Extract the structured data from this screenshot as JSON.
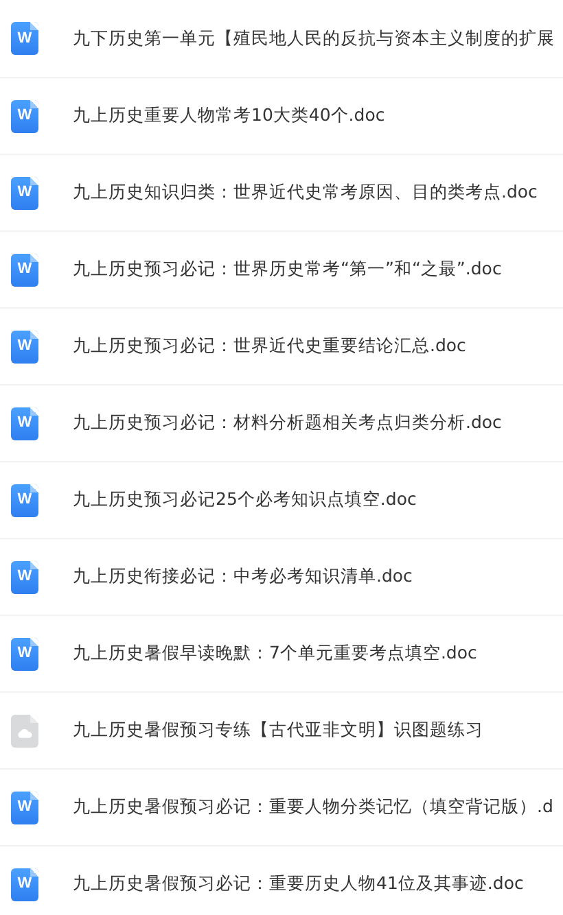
{
  "files": [
    {
      "kind": "word",
      "badge": "W",
      "name": "九下历史第一单元【殖民地人民的反抗与资本主义制度的扩展"
    },
    {
      "kind": "word",
      "badge": "W",
      "name": "九上历史重要人物常考10大类40个.doc"
    },
    {
      "kind": "word",
      "badge": "W",
      "name": "九上历史知识归类：世界近代史常考原因、目的类考点.doc"
    },
    {
      "kind": "word",
      "badge": "W",
      "name": "九上历史预习必记：世界历史常考“第一”和“之最”.doc"
    },
    {
      "kind": "word",
      "badge": "W",
      "name": "九上历史预习必记：世界近代史重要结论汇总.doc"
    },
    {
      "kind": "word",
      "badge": "W",
      "name": "九上历史预习必记：材料分析题相关考点归类分析.doc"
    },
    {
      "kind": "word",
      "badge": "W",
      "name": "九上历史预习必记25个必考知识点填空.doc"
    },
    {
      "kind": "word",
      "badge": "W",
      "name": "九上历史衔接必记：中考必考知识清单.doc"
    },
    {
      "kind": "word",
      "badge": "W",
      "name": "九上历史暑假早读晚默：7个单元重要考点填空.doc"
    },
    {
      "kind": "cloud",
      "name": "九上历史暑假预习专练【古代亚非文明】识图题练习"
    },
    {
      "kind": "word",
      "badge": "W",
      "name": "九上历史暑假预习必记：重要人物分类记忆（填空背记版）.d"
    },
    {
      "kind": "word",
      "badge": "W",
      "name": "九上历史暑假预习必记：重要历史人物41位及其事迹.doc"
    }
  ]
}
